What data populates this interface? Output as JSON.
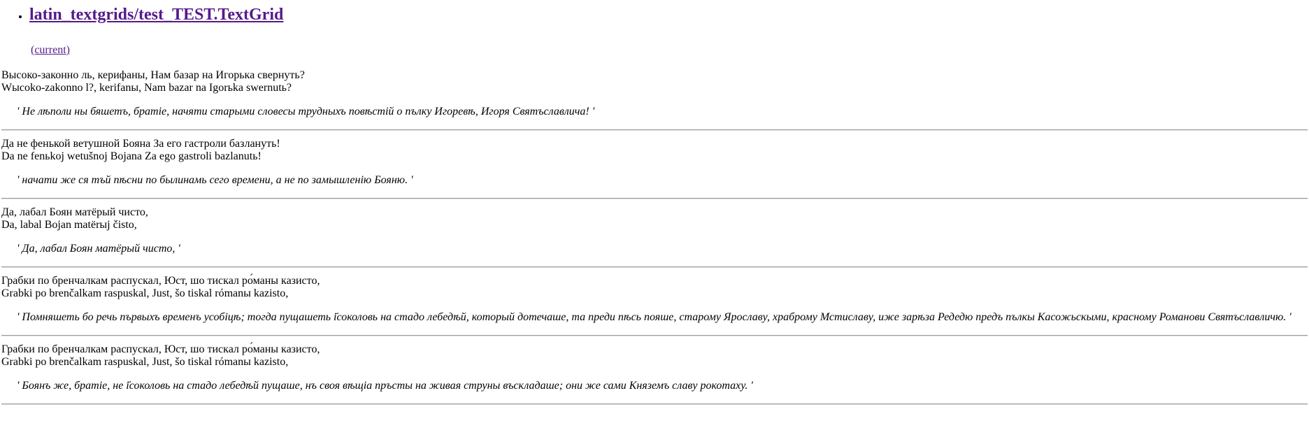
{
  "header": {
    "title_link": "latin_textgrids/test_TEST.TextGrid",
    "current_link": "(current)"
  },
  "entries": [
    {
      "cyrillic": "Высоко-законно ль, керифаны, Нам базар на Игорька свернуть?",
      "latin": "Wысoko-zakonno l?, kerifanы, Nam bazar na Igorьka swernutь?",
      "quote": "' Не лѣполи ны бяшетъ, братіе, начяти старыми словесы трудныхъ повѣстій о пълку Игоревѣ, Игоря Святъславлича! '"
    },
    {
      "cyrillic": "Да не фенькой ветушной Бояна За его гастроли базлануть!",
      "latin": "Da ne fenьkoj wetušnoj Bojana Za ego gastroli bazlanutь!",
      "quote": "' начати же ся тъй пѣсни по былинамь сего времени, а не по замышленію Бояню. '"
    },
    {
      "cyrillic": "Да, лабал Боян матёрый чисто,",
      "latin": "Da, labal Bojan matёrыj čisto,",
      "quote": "' Да, лабал Боян матёрый чисто, '"
    },
    {
      "cyrillic": "Грабки по бренчалкам распускал, Юст, шо тискал ро́маны казисто,",
      "latin": "Grabki po brenčalkam raspuskal, Just, šo tiskal rómanы kazisto,",
      "quote": "' Помняшеть бо речь първыхъ временъ усобіцѣ; тогда пущашеть і҃соколовь на стадо лебедѣй, который дотечаше, та преди пѣсь пояше, старому Ярославу, храброму Мстиславу, иже зарѣза Редедю предъ пълкы Касожьскыми, красному Романови Святъславличю. '"
    },
    {
      "cyrillic": "Грабки по бренчалкам распускал, Юст, шо тискал ро́маны казисто,",
      "latin": "Grabki po brenčalkam raspuskal, Just, šo tiskal rómanы kazisto,",
      "quote": "' Боянъ же, братіе, не і҃соколовь на стадо лебедѣй пущаше, нъ своя вѣщіа пръсты на живая струны въскладаше; они же сами Княземъ славу рокотаху. '"
    }
  ]
}
